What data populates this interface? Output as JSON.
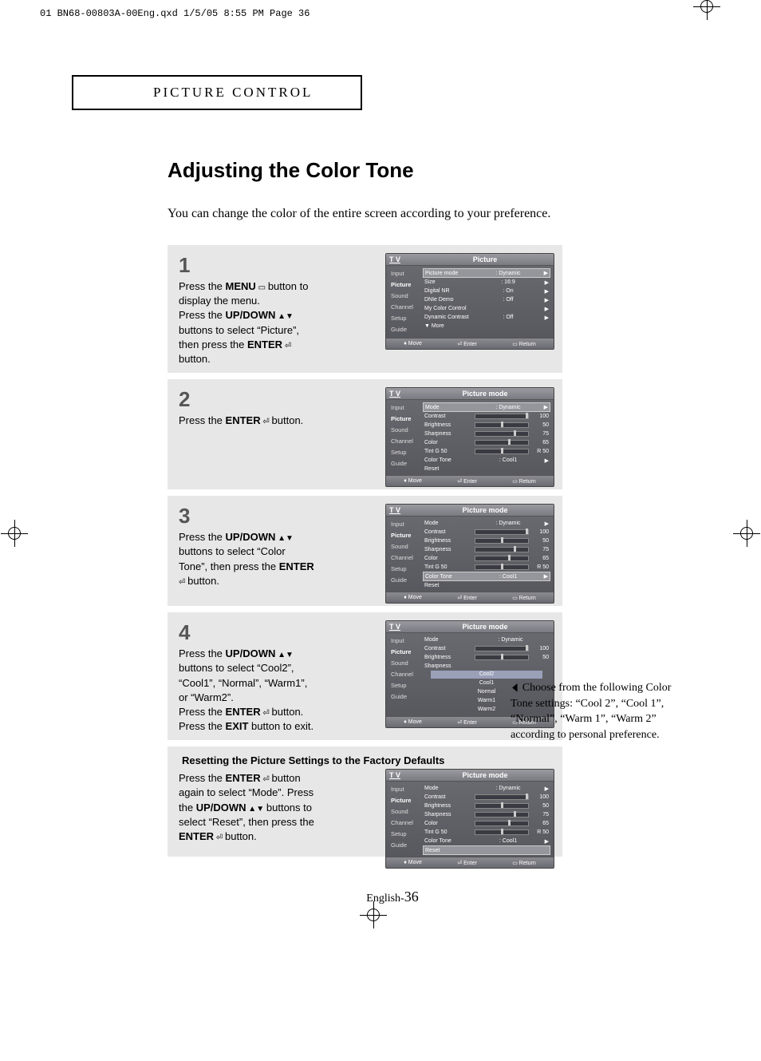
{
  "print_header": "01 BN68-00803A-00Eng.qxd  1/5/05 8:55 PM  Page 36",
  "section_header": "PICTURE CONTROL",
  "title": "Adjusting the Color Tone",
  "intro": "You can change the color of the entire screen according to your preference.",
  "steps": {
    "s1": {
      "num": "1",
      "line1a": "Press the ",
      "line1b": "MENU",
      "line1c": " button to display the menu.",
      "line2a": "Press the ",
      "line2b": "UP/DOWN",
      "line2c": " buttons to select “Picture”, then press the ",
      "line2d": "ENTER",
      "line2e": " button."
    },
    "s2": {
      "num": "2",
      "line1a": "Press the ",
      "line1b": "ENTER",
      "line1c": " button."
    },
    "s3": {
      "num": "3",
      "line1a": "Press the ",
      "line1b": "UP/DOWN",
      "line1c": " buttons to select “Color Tone”, then press the ",
      "line1d": "ENTER",
      "line1e": " button."
    },
    "s4": {
      "num": "4",
      "line1a": "Press the ",
      "line1b": "UP/DOWN",
      "line1c": " buttons to select “Cool2”, “Cool1”, “Normal”, “Warm1”, or “Warm2”.",
      "line2a": "Press the ",
      "line2b": "ENTER",
      "line2c": " button. Press the ",
      "line2d": "EXIT",
      "line2e": " button to exit."
    },
    "reset": {
      "subtitle": "Resetting the Picture Settings to the Factory Defaults",
      "line1a": "Press the ",
      "line1b": "ENTER",
      "line1c": " button again to select “Mode”. Press the ",
      "line1d": "UP/DOWN",
      "line1e": " buttons to select “Reset”, then press the ",
      "line1f": "ENTER",
      "line1g": " button."
    }
  },
  "osd_common": {
    "tv": "T V",
    "side": {
      "input": "Input",
      "picture": "Picture",
      "sound": "Sound",
      "channel": "Channel",
      "setup": "Setup",
      "guide": "Guide"
    },
    "footer": {
      "move": "Move",
      "enter": "Enter",
      "return": "Return"
    }
  },
  "osd1": {
    "title": "Picture",
    "rows": {
      "picture_mode": {
        "label": "Picture mode",
        "value": ": Dynamic"
      },
      "size": {
        "label": "Size",
        "value": ": 16:9"
      },
      "digital_nr": {
        "label": "Digital NR",
        "value": ": On"
      },
      "dnie": {
        "label": "DNIe Demo",
        "value": ": Off"
      },
      "mcc": {
        "label": "My Color Control",
        "value": ""
      },
      "dc": {
        "label": "Dynamic Contrast",
        "value": ": Off"
      },
      "more": {
        "label": "▼ More",
        "value": ""
      }
    }
  },
  "osd2": {
    "title": "Picture mode",
    "rows": {
      "mode": {
        "label": "Mode",
        "value": ": Dynamic"
      },
      "contrast": {
        "label": "Contrast",
        "num": "100"
      },
      "brightness": {
        "label": "Brightness",
        "num": "50"
      },
      "sharpness": {
        "label": "Sharpness",
        "num": "75"
      },
      "color": {
        "label": "Color",
        "num": "65"
      },
      "tint": {
        "label": "Tint  G 50",
        "num": "R 50"
      },
      "ctone": {
        "label": "Color Tone",
        "value": ": Cool1"
      },
      "reset": {
        "label": "Reset",
        "value": ""
      }
    }
  },
  "osd4_options": {
    "o1": "Cool2",
    "o2": "Cool1",
    "o3": "Normal",
    "o4": "Warm1",
    "o5": "Warm2"
  },
  "side_note": "Choose from the following Color Tone settings: “Cool 2”, “Cool 1”, “Normal”, “Warm 1”, “Warm 2” according to personal preference.",
  "footer": {
    "lang": "English-",
    "page": "36"
  }
}
